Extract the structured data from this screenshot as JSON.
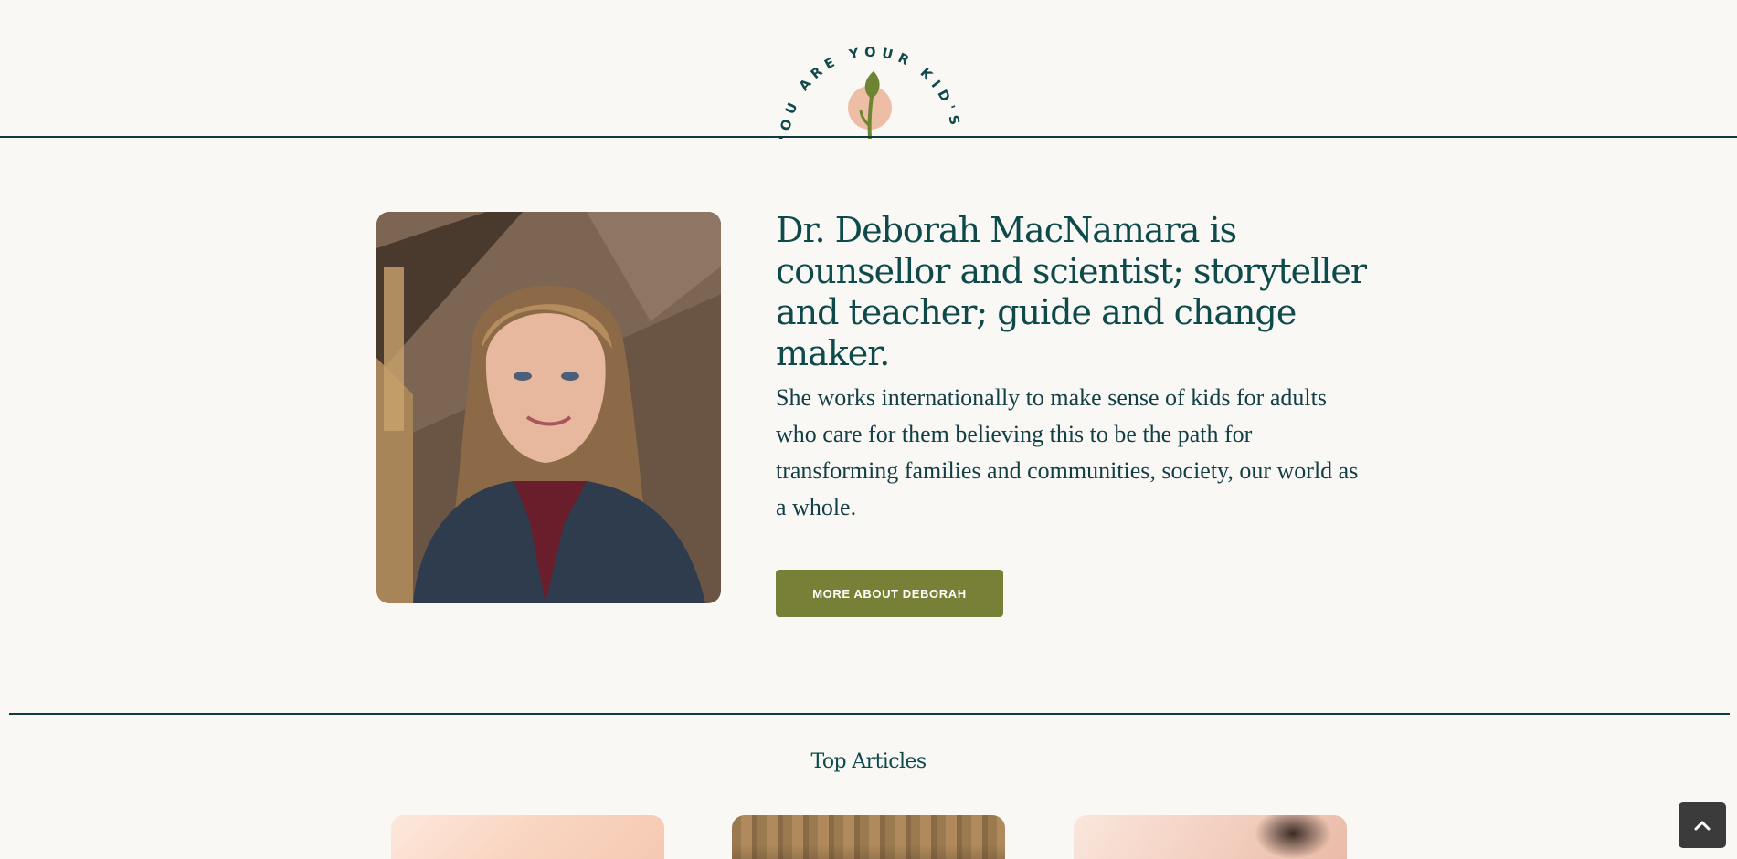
{
  "header": {
    "emblem_text": "YOU ARE YOUR KID'S BEST BET",
    "emblem_icon": "sprout-logo-icon"
  },
  "hero": {
    "portrait_icon": "portrait-photo",
    "heading": "Dr. Deborah MacNamara is counsellor and scientist; storyteller and teacher; guide and change maker.",
    "bio": "She works internationally to make sense of kids for adults who care for them believing this to be the path for transforming families and communities, society, our world as a whole.",
    "cta_label": "MORE ABOUT DEBORAH"
  },
  "articles": {
    "title": "Top Articles"
  },
  "scroll_top": {
    "icon": "chevron-up-icon"
  },
  "colors": {
    "background": "#faf8f5",
    "text": "#0e4a4a",
    "accent_green": "#778036",
    "rule": "#0f3d3d",
    "scroll_button": "#3b3b3b"
  }
}
